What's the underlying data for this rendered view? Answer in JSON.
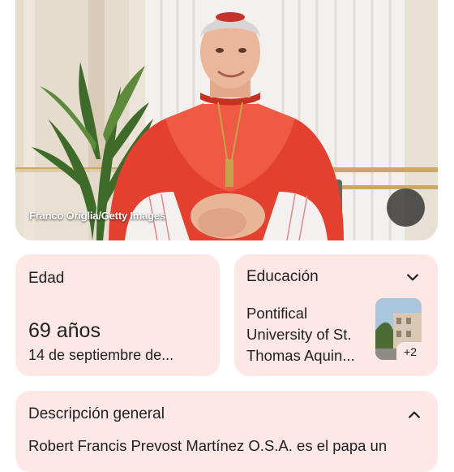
{
  "hero": {
    "credit": "Franco Origlia/Getty Images",
    "image_button_icon": "image-icon"
  },
  "age": {
    "title": "Edad",
    "value": "69 años",
    "birth": "14 de septiembre de..."
  },
  "education": {
    "title": "Educación",
    "lines": [
      "Pontifical",
      "University of St.",
      "Thomas Aquin..."
    ],
    "more_count": "+2",
    "toggle_icon": "chevron-down-icon"
  },
  "overview": {
    "title": "Descripción general",
    "text": "Robert Francis Prevost Martínez O.S.A. es el papa un",
    "toggle_icon": "chevron-up-icon"
  },
  "colors": {
    "card_bg": "#fde8e6",
    "text": "#1f1f1f",
    "cassock_red": "#e4402f"
  }
}
